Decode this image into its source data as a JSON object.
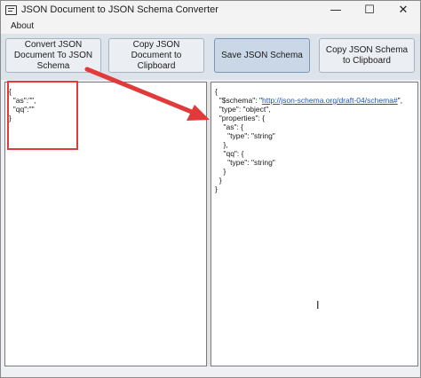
{
  "window": {
    "title": "JSON Document to JSON Schema Converter",
    "controls": {
      "minimize": "—",
      "maximize": "☐",
      "close": "✕"
    }
  },
  "menu": {
    "about": "About"
  },
  "toolbar": {
    "convert": "Convert JSON Document To JSON Schema",
    "copy_document": "Copy JSON Document to Clipboard",
    "save_schema": "Save JSON Schema",
    "copy_schema": "Copy JSON Schema to Clipboard"
  },
  "left_editor": {
    "lines": [
      "{",
      "  \"as\":\"\",",
      "  \"qq\":\"\"",
      "}"
    ]
  },
  "right_editor": {
    "line1_prefix": "{",
    "schema_key": "  \"$schema\": \"",
    "schema_url": "http://json-schema.org/draft-04/schema#",
    "schema_suffix": "\",",
    "rest": "  \"type\": \"object\",\n  \"properties\": {\n    \"as\": {\n      \"type\": \"string\"\n    },\n    \"qq\": {\n      \"type\": \"string\"\n    }\n  }\n}"
  },
  "colors": {
    "highlight": "#e23a3a",
    "arrow": "#e23a3a",
    "link": "#1a56b8"
  }
}
